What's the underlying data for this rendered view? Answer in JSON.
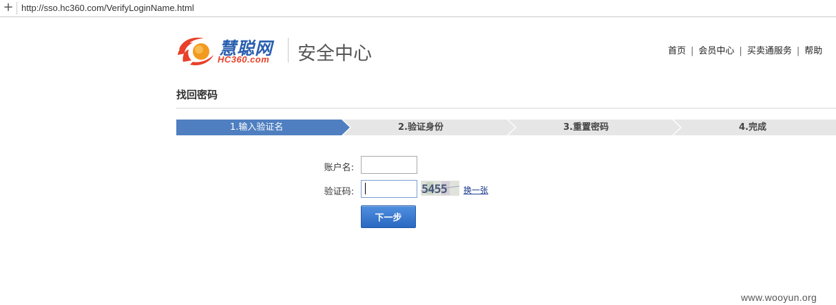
{
  "browser": {
    "url": "http://sso.hc360.com/VerifyLoginName.html"
  },
  "header": {
    "logo_cn": "慧聪网",
    "logo_en": "HC360.com",
    "subtitle": "安全中心",
    "nav": [
      {
        "label": "首页"
      },
      {
        "label": "会员中心"
      },
      {
        "label": "买卖通服务"
      },
      {
        "label": "帮助"
      }
    ]
  },
  "page": {
    "title": "找回密码"
  },
  "steps": [
    {
      "label": "1.输入验证名",
      "active": true
    },
    {
      "label": "2.验证身份",
      "active": false
    },
    {
      "label": "3.重置密码",
      "active": false
    },
    {
      "label": "4.完成",
      "active": false
    }
  ],
  "form": {
    "account_label": "账户名:",
    "account_value": "",
    "captcha_label": "验证码:",
    "captcha_value": "",
    "captcha_text": "5455",
    "refresh_label": "换一张",
    "next_label": "下一步"
  },
  "colors": {
    "step_active": "#4f7fc0",
    "step_inactive": "#e6e6e6",
    "link": "#1a3b8c",
    "button": "#2a68c2"
  },
  "watermark": "www.wooyun.org"
}
